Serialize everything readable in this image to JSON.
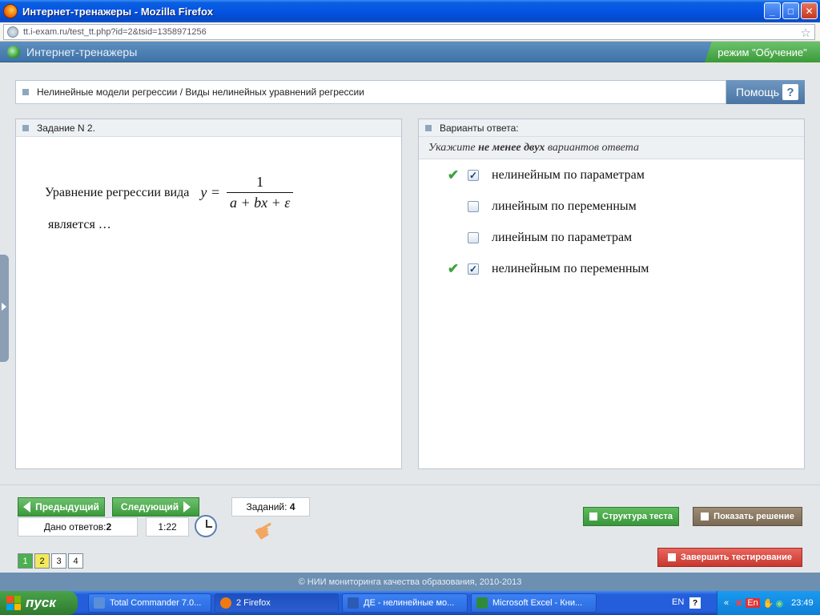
{
  "window": {
    "title": "Интернет-тренажеры - Mozilla Firefox",
    "minimize": "_",
    "maximize": "□",
    "close": "✕"
  },
  "address": {
    "url": "tt.i-exam.ru/test_tt.php?id=2&tsid=1358971256"
  },
  "app": {
    "title": "Интернет-тренажеры",
    "mode": "режим \"Обучение\""
  },
  "breadcrumb": "Нелинейные модели регрессии / Виды нелинейных уравнений регрессии",
  "help": {
    "label": "Помощь",
    "icon": "?"
  },
  "task": {
    "header": "Задание N 2.",
    "text_before": "Уравнение регрессии вида",
    "formula_lhs": "y =",
    "formula_numerator": "1",
    "formula_denominator": "a + bx + ε",
    "text_after": "является …"
  },
  "answers": {
    "header": "Варианты ответа:",
    "hint_prefix": "Укажите",
    "hint_bold": "не менее двух",
    "hint_suffix": "вариантов ответа",
    "options": [
      {
        "label": "нелинейным по параметрам",
        "checked": true,
        "correct_mark": "✔",
        "box_mark": "✓"
      },
      {
        "label": "линейным по переменным",
        "checked": false,
        "correct_mark": "",
        "box_mark": ""
      },
      {
        "label": "линейным по параметрам",
        "checked": false,
        "correct_mark": "",
        "box_mark": ""
      },
      {
        "label": "нелинейным по переменным",
        "checked": true,
        "correct_mark": "✔",
        "box_mark": "✓"
      }
    ]
  },
  "controls": {
    "prev": "Предыдущий",
    "next": "Следующий",
    "answered_label": "Дано ответов:",
    "answered_value": "2",
    "timer": "1:22",
    "tasks_label": "Заданий:",
    "tasks_value": "4",
    "structure": "Структура теста",
    "show_solution": "Показать решение",
    "finish": "Завершить тестирование",
    "pages": [
      "1",
      "2",
      "3",
      "4"
    ]
  },
  "colors": {
    "page1": "#4caf50",
    "page2": "#f3ea5a",
    "structure": "#4aa54a",
    "solution": "#8c7a63",
    "finish": "#d9473f"
  },
  "copyright": "© НИИ мониторинга качества образования, 2010-2013",
  "taskbar": {
    "start": "пуск",
    "items": [
      "Total Commander 7.0...",
      "2 Firefox",
      "ДЕ - нелинейные мо...",
      "Microsoft Excel - Кни..."
    ],
    "lang": "EN",
    "tray_lang": "En",
    "clock": "23:49",
    "tray_help": "?"
  }
}
